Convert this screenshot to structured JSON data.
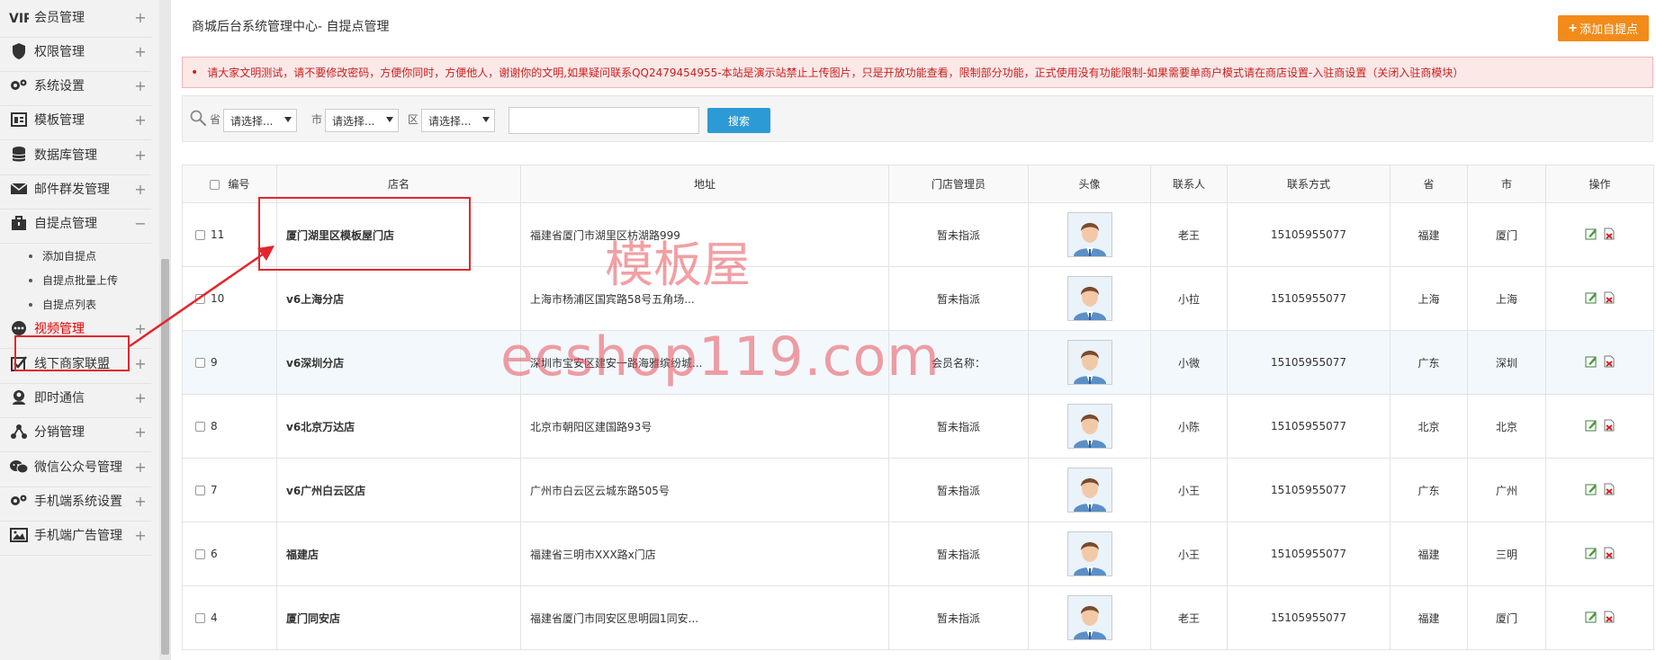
{
  "sidebar": {
    "items": [
      {
        "label": "会员管理",
        "icon": "vip-icon",
        "toggle": "+"
      },
      {
        "label": "权限管理",
        "icon": "shield-icon",
        "toggle": "+"
      },
      {
        "label": "系统设置",
        "icon": "gears-icon",
        "toggle": "+"
      },
      {
        "label": "模板管理",
        "icon": "template-icon",
        "toggle": "+"
      },
      {
        "label": "数据库管理",
        "icon": "database-icon",
        "toggle": "+"
      },
      {
        "label": "邮件群发管理",
        "icon": "envelope-icon",
        "toggle": "+"
      },
      {
        "label": "自提点管理",
        "icon": "briefcase-icon",
        "toggle": "−"
      },
      {
        "label": "视频管理",
        "icon": "chat-bubble-icon",
        "toggle": "+"
      },
      {
        "label": "线下商家联盟",
        "icon": "checkbox-icon",
        "toggle": "+"
      },
      {
        "label": "即时通信",
        "icon": "user-chat-icon",
        "toggle": "+"
      },
      {
        "label": "分销管理",
        "icon": "share-nodes-icon",
        "toggle": "+"
      },
      {
        "label": "微信公众号管理",
        "icon": "wechat-icon",
        "toggle": "+"
      },
      {
        "label": "手机端系统设置",
        "icon": "gears-icon",
        "toggle": "+"
      },
      {
        "label": "手机端广告管理",
        "icon": "image-icon",
        "toggle": "+"
      }
    ],
    "subitems": [
      {
        "label": "添加自提点"
      },
      {
        "label": "自提点批量上传"
      },
      {
        "label": "自提点列表"
      }
    ]
  },
  "header": {
    "breadcrumb": "商城后台系统管理中心- 自提点管理",
    "add_button": "添加自提点",
    "add_button_icon": "+"
  },
  "notice": {
    "bullet": "•",
    "text": "请大家文明测试，请不要修改密码，方便你同时，方便他人，谢谢你的文明,如果疑问联系QQ2479454955-本站是演示站禁止上传图片，只是开放功能查看，限制部分功能，正式使用没有功能限制-如果需要单商户模式请在商店设置-入驻商设置（关闭入驻商模块）"
  },
  "filter": {
    "province_label": "省",
    "city_label": "市",
    "district_label": "区",
    "province_value": "请选择...",
    "city_value": "请选择...",
    "district_value": "请选择...",
    "keyword_value": "",
    "search_button": "搜索"
  },
  "table": {
    "headers": [
      "编号",
      "店名",
      "地址",
      "门店管理员",
      "头像",
      "联系人",
      "联系方式",
      "省",
      "市",
      "操作"
    ],
    "rows": [
      {
        "id": "11",
        "name": "厦门湖里区模板屋门店",
        "address": "福建省厦门市湖里区枋湖路999",
        "admin": "暂未指派",
        "contact": "老王",
        "phone": "15105955077",
        "province": "福建",
        "city": "厦门"
      },
      {
        "id": "10",
        "name": "v6上海分店",
        "address": "上海市杨浦区国宾路58号五角场...",
        "admin": "暂未指派",
        "contact": "小拉",
        "phone": "15105955077",
        "province": "上海",
        "city": "上海"
      },
      {
        "id": "9",
        "name": "v6深圳分店",
        "address": "深圳市宝安区建安一路海雅缤纷城...",
        "admin": "会员名称：",
        "contact": "小微",
        "phone": "15105955077",
        "province": "广东",
        "city": "深圳"
      },
      {
        "id": "8",
        "name": "v6北京万达店",
        "address": "北京市朝阳区建国路93号",
        "admin": "暂未指派",
        "contact": "小陈",
        "phone": "15105955077",
        "province": "北京",
        "city": "北京"
      },
      {
        "id": "7",
        "name": "v6广州白云区店",
        "address": "广州市白云区云城东路505号",
        "admin": "暂未指派",
        "contact": "小王",
        "phone": "15105955077",
        "province": "广东",
        "city": "广州"
      },
      {
        "id": "6",
        "name": "福建店",
        "address": "福建省三明市XXX路x门店",
        "admin": "暂未指派",
        "contact": "小王",
        "phone": "15105955077",
        "province": "福建",
        "city": "三明"
      },
      {
        "id": "4",
        "name": "厦门同安店",
        "address": "福建省厦门市同安区思明园1同安...",
        "admin": "暂未指派",
        "contact": "老王",
        "phone": "15105955077",
        "province": "福建",
        "city": "厦门"
      }
    ]
  },
  "watermark": {
    "line1": "模板屋",
    "line2": "ecshop119.com"
  },
  "colors": {
    "accent_orange": "#f28b1a",
    "search_blue": "#2c9ad4",
    "notice_red": "#c8201d",
    "annotation_red": "#e3262d",
    "active_menu": "#e60000"
  }
}
